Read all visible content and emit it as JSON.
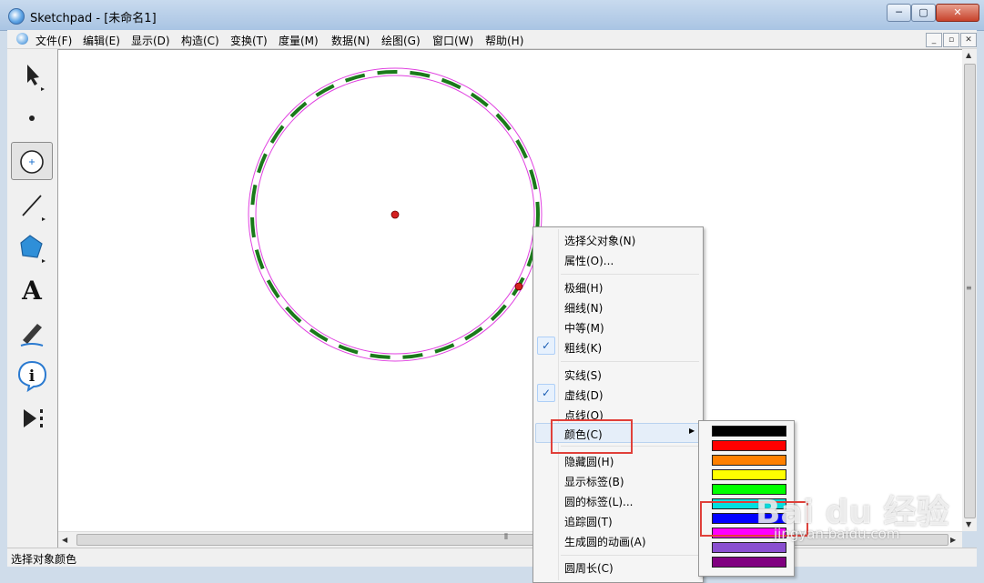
{
  "window": {
    "title": "Sketchpad  - [未命名1]"
  },
  "window_buttons": {
    "minimize": "─",
    "maximize": "▢",
    "close": "✕"
  },
  "menubar": {
    "items": [
      "文件(F)",
      "编辑(E)",
      "显示(D)",
      "构造(C)",
      "变换(T)",
      "度量(M)",
      "数据(N)",
      "绘图(G)",
      "窗口(W)",
      "帮助(H)"
    ],
    "mdi_buttons": [
      "_",
      "▫",
      "✕"
    ]
  },
  "toolbox": {
    "tools": [
      {
        "name": "arrow-tool",
        "icon": "arrow-icon"
      },
      {
        "name": "point-tool",
        "icon": "point-icon"
      },
      {
        "name": "compass-tool",
        "icon": "compass-icon",
        "active": true
      },
      {
        "name": "straightedge-tool",
        "icon": "line-icon"
      },
      {
        "name": "polygon-tool",
        "icon": "polygon-icon"
      },
      {
        "name": "text-tool",
        "icon": "text-icon",
        "glyph": "A"
      },
      {
        "name": "marker-tool",
        "icon": "marker-icon"
      },
      {
        "name": "information-tool",
        "icon": "info-icon",
        "glyph": "i"
      },
      {
        "name": "custom-tool",
        "icon": "custom-tool-icon"
      }
    ]
  },
  "canvas": {
    "circle_stroke_color": "#1a7a1a",
    "selection_color": "#e040e0",
    "point_color": "#d42020"
  },
  "context_menu": {
    "items": [
      {
        "label": "选择父对象(N)"
      },
      {
        "label": "属性(O)..."
      },
      {
        "label": "极细(H)"
      },
      {
        "label": "细线(N)"
      },
      {
        "label": "中等(M)"
      },
      {
        "label": "粗线(K)",
        "checked": true
      },
      {
        "label": "实线(S)"
      },
      {
        "label": "虚线(D)",
        "checked": true
      },
      {
        "label": "点线(O)"
      },
      {
        "label": "颜色(C)",
        "submenu": true,
        "highlighted": true
      },
      {
        "label": "隐藏圆(H)"
      },
      {
        "label": "显示标签(B)"
      },
      {
        "label": "圆的标签(L)..."
      },
      {
        "label": "追踪圆(T)"
      },
      {
        "label": "生成圆的动画(A)"
      },
      {
        "label": "圆周长(C)"
      }
    ]
  },
  "color_submenu": {
    "swatches": [
      "#000000",
      "#ff0000",
      "#ff8000",
      "#ffff00",
      "#00ff00",
      "#00e0e0",
      "#0000ff",
      "#ff00ff",
      "#8a4fd0",
      "#800080"
    ],
    "selected_index": 6
  },
  "statusbar": {
    "text": "选择对象颜色"
  },
  "watermark": {
    "text": "Bai du 经验",
    "url": "jingyan.baidu.com"
  }
}
